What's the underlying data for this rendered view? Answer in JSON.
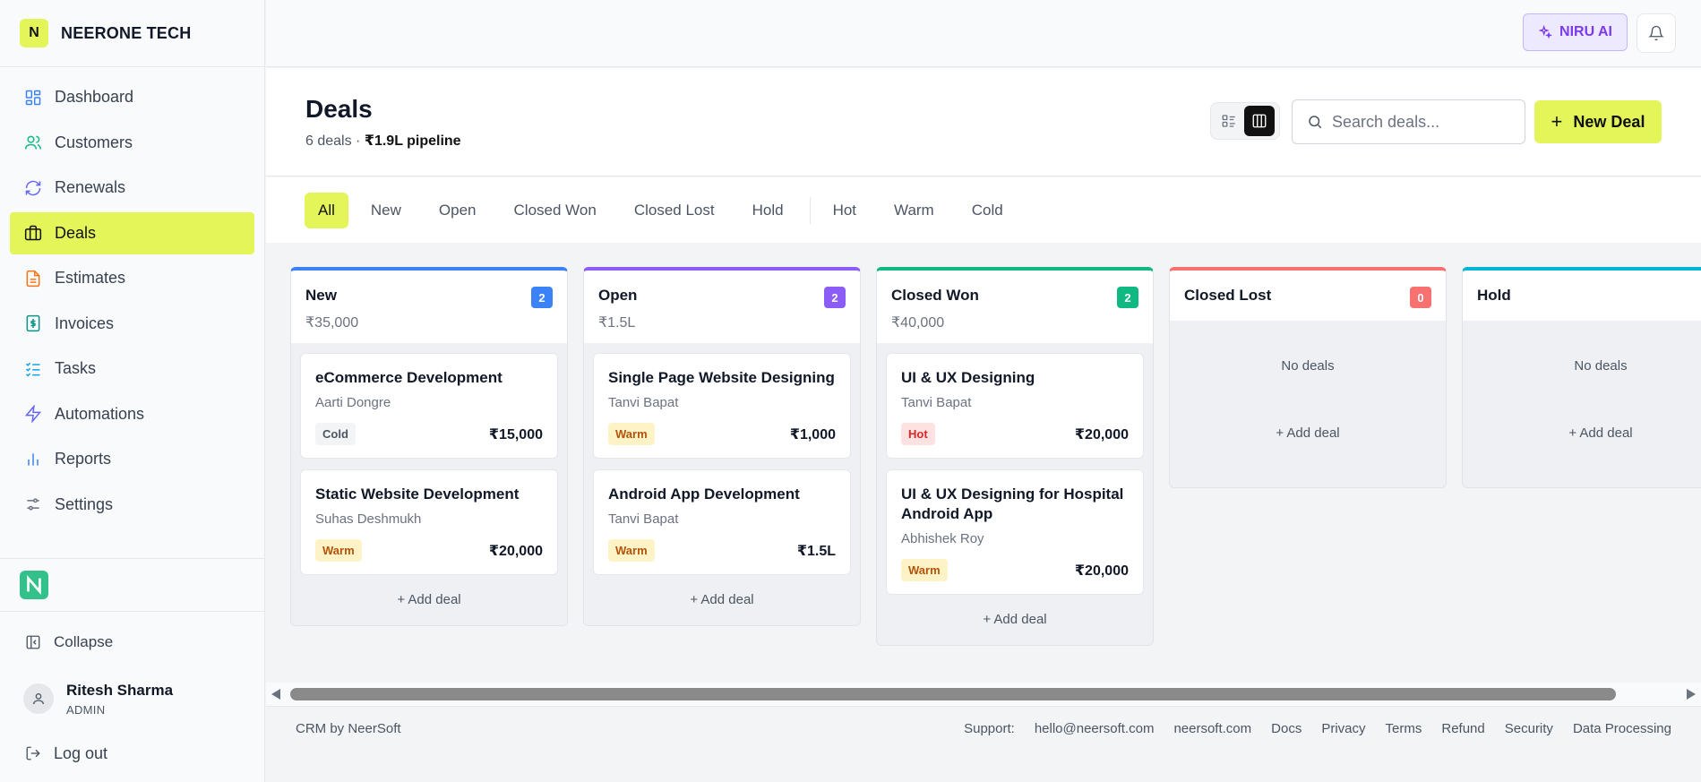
{
  "brand": {
    "initial": "N",
    "name": "NEERONE TECH"
  },
  "nav": [
    {
      "label": "Dashboard",
      "icon": "dashboard-icon",
      "active": false
    },
    {
      "label": "Customers",
      "icon": "users-icon",
      "active": false
    },
    {
      "label": "Renewals",
      "icon": "refresh-icon",
      "active": false
    },
    {
      "label": "Deals",
      "icon": "briefcase-icon",
      "active": true
    },
    {
      "label": "Estimates",
      "icon": "document-icon",
      "active": false
    },
    {
      "label": "Invoices",
      "icon": "invoice-icon",
      "active": false
    },
    {
      "label": "Tasks",
      "icon": "checklist-icon",
      "active": false
    },
    {
      "label": "Automations",
      "icon": "bolt-icon",
      "active": false
    },
    {
      "label": "Reports",
      "icon": "bar-chart-icon",
      "active": false
    },
    {
      "label": "Settings",
      "icon": "sliders-icon",
      "active": false
    }
  ],
  "sidebar_bottom": {
    "collapse_label": "Collapse",
    "user_name": "Ritesh Sharma",
    "user_role": "ADMIN",
    "logout_label": "Log out"
  },
  "topbar": {
    "ai_label": "NIRU AI"
  },
  "header": {
    "title": "Deals",
    "deal_count": "6 deals",
    "separator": " · ",
    "pipeline": "₹1.9L pipeline",
    "search_placeholder": "Search deals...",
    "new_deal_label": "New Deal"
  },
  "filters": {
    "stages": [
      "All",
      "New",
      "Open",
      "Closed Won",
      "Closed Lost",
      "Hold"
    ],
    "temps": [
      "Hot",
      "Warm",
      "Cold"
    ],
    "active": "All"
  },
  "columns": [
    {
      "title": "New",
      "total": "₹35,000",
      "count": "2",
      "color": "#3b82f6",
      "cards": [
        {
          "title": "eCommerce Development",
          "person": "Aarti Dongre",
          "tag": "Cold",
          "amount": "₹15,000"
        },
        {
          "title": "Static Website Development",
          "person": "Suhas Deshmukh",
          "tag": "Warm",
          "amount": "₹20,000"
        }
      ]
    },
    {
      "title": "Open",
      "total": "₹1.5L",
      "count": "2",
      "color": "#8b5cf6",
      "cards": [
        {
          "title": "Single Page Website Designing",
          "person": "Tanvi Bapat",
          "tag": "Warm",
          "amount": "₹1,000"
        },
        {
          "title": "Android App Development",
          "person": "Tanvi Bapat",
          "tag": "Warm",
          "amount": "₹1.5L"
        }
      ]
    },
    {
      "title": "Closed Won",
      "total": "₹40,000",
      "count": "2",
      "color": "#10b981",
      "cards": [
        {
          "title": "UI & UX Designing",
          "person": "Tanvi Bapat",
          "tag": "Hot",
          "amount": "₹20,000"
        },
        {
          "title": "UI & UX Designing for Hospital Android App",
          "person": "Abhishek Roy",
          "tag": "Warm",
          "amount": "₹20,000"
        }
      ]
    },
    {
      "title": "Closed Lost",
      "total": "",
      "count": "0",
      "color": "#f87171",
      "cards": []
    },
    {
      "title": "Hold",
      "total": "",
      "count": "",
      "color": "#06b6d4",
      "cards": []
    }
  ],
  "empty_label": "No deals",
  "add_deal_label": "+ Add deal",
  "footer": {
    "brand": "CRM by NeerSoft",
    "support_label": "Support:",
    "links": [
      "hello@neersoft.com",
      "neersoft.com",
      "Docs",
      "Privacy",
      "Terms",
      "Refund",
      "Security",
      "Data Processing"
    ]
  }
}
